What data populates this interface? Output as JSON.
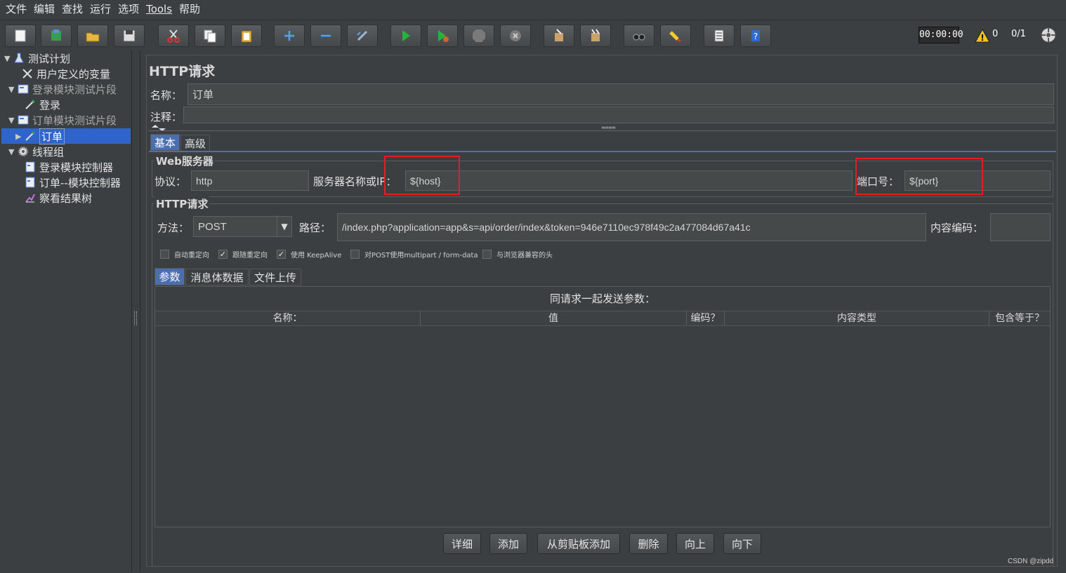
{
  "menu": [
    "文件",
    "编辑",
    "查找",
    "运行",
    "选项",
    "Tools",
    "帮助"
  ],
  "toolbar": {
    "timer": "00:00:00",
    "warnings": "0",
    "threads": "0/1",
    "buttons": [
      "new-icon",
      "templates-icon",
      "open-icon",
      "save-icon",
      "cut-icon",
      "copy-icon",
      "paste-icon",
      "expand-icon",
      "collapse-icon",
      "toggle-icon",
      "start-icon",
      "start-no-pause-icon",
      "stop-icon",
      "shutdown-icon",
      "clear-icon",
      "clear-all-icon",
      "search-icon",
      "reset-search-icon",
      "function-helper-icon",
      "help-icon"
    ]
  },
  "tree": {
    "items": [
      {
        "label": "测试计划",
        "icon": "flask-icon",
        "arrow": "▼"
      },
      {
        "label": "用户定义的变量",
        "icon": "wrench-icon",
        "arrow": ""
      },
      {
        "label": "登录模块测试片段",
        "icon": "fragment-icon",
        "arrow": "▼"
      },
      {
        "label": "登录",
        "icon": "sampler-icon",
        "arrow": ""
      },
      {
        "label": "订单模块测试片段",
        "icon": "fragment-icon",
        "arrow": "▼"
      },
      {
        "label": "订单",
        "icon": "sampler-icon",
        "arrow": "▶"
      },
      {
        "label": "线程组",
        "icon": "gear-icon",
        "arrow": "▼"
      },
      {
        "label": "登录模块控制器",
        "icon": "controller-icon",
        "arrow": ""
      },
      {
        "label": "订单--模块控制器",
        "icon": "controller-icon",
        "arrow": ""
      },
      {
        "label": "察看结果树",
        "icon": "listener-icon",
        "arrow": ""
      }
    ]
  },
  "main": {
    "title": "HTTP请求",
    "name_label": "名称：",
    "name_value": "订单",
    "comment_label": "注释：",
    "comment_value": "",
    "tabs": [
      "基本",
      "高级"
    ],
    "web_server": {
      "title": "Web服务器",
      "protocol_label": "协议：",
      "protocol_value": "http",
      "server_label": "服务器名称或IP：",
      "server_value": "${host}",
      "port_label": "端口号：",
      "port_value": "${port}"
    },
    "http_request": {
      "title": "HTTP请求",
      "method_label": "方法：",
      "method_value": "POST",
      "path_label": "路径：",
      "path_value": "/index.php?application=app&s=api/order/index&token=946e7110ec978f49c2a477084d67a41c",
      "encoding_label": "内容编码：",
      "encoding_value": ""
    },
    "checkboxes": [
      {
        "label": "自动重定向",
        "checked": false
      },
      {
        "label": "跟随重定向",
        "checked": true
      },
      {
        "label": "使用 KeepAlive",
        "checked": true
      },
      {
        "label": "对POST使用multipart / form-data",
        "checked": false
      },
      {
        "label": "与浏览器兼容的头",
        "checked": false
      }
    ],
    "sub_tabs": [
      "参数",
      "消息体数据",
      "文件上传"
    ],
    "params": {
      "caption": "同请求一起发送参数：",
      "columns": [
        "名称：",
        "值",
        "编码？",
        "内容类型",
        "包含等于？"
      ]
    },
    "buttons": [
      "详细",
      "添加",
      "从剪贴板添加",
      "删除",
      "向上",
      "向下"
    ]
  },
  "watermark": "CSDN @zipdd"
}
